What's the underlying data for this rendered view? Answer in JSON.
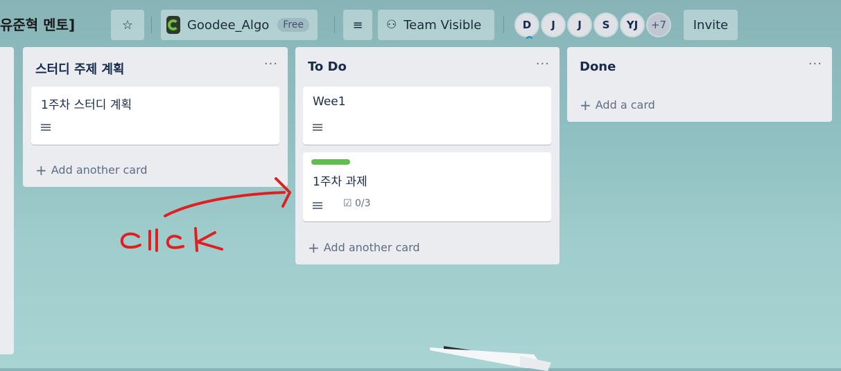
{
  "header": {
    "board_title": "유준혁 멘토]",
    "star_icon": "star-icon",
    "org_name": "Goodee_Algo",
    "org_badge": "Free",
    "team_visibility": "Team Visible",
    "members": [
      "D",
      "J",
      "J",
      "S",
      "YJ"
    ],
    "members_more": "+7",
    "invite_label": "Invite"
  },
  "lists": [
    {
      "title": "스터디 주제 계획",
      "menu": "···",
      "cards": [
        {
          "title": "1주차 스터디 계획",
          "has_description": true
        }
      ],
      "add_label": "Add another card"
    },
    {
      "title": "To Do",
      "menu": "···",
      "cards": [
        {
          "title": "Wee1",
          "has_description": true
        },
        {
          "title": "1주차 과제",
          "label_color": "#61bd4f",
          "has_description": true,
          "checklist": "0/3"
        }
      ],
      "add_label": "Add another card"
    },
    {
      "title": "Done",
      "menu": "···",
      "cards": [],
      "add_label": "Add a card"
    }
  ],
  "annotation": {
    "text": "clTck",
    "color": "#e02020"
  },
  "colors": {
    "list_bg": "#ebecf0",
    "card_bg": "#ffffff",
    "label_green": "#61bd4f"
  }
}
